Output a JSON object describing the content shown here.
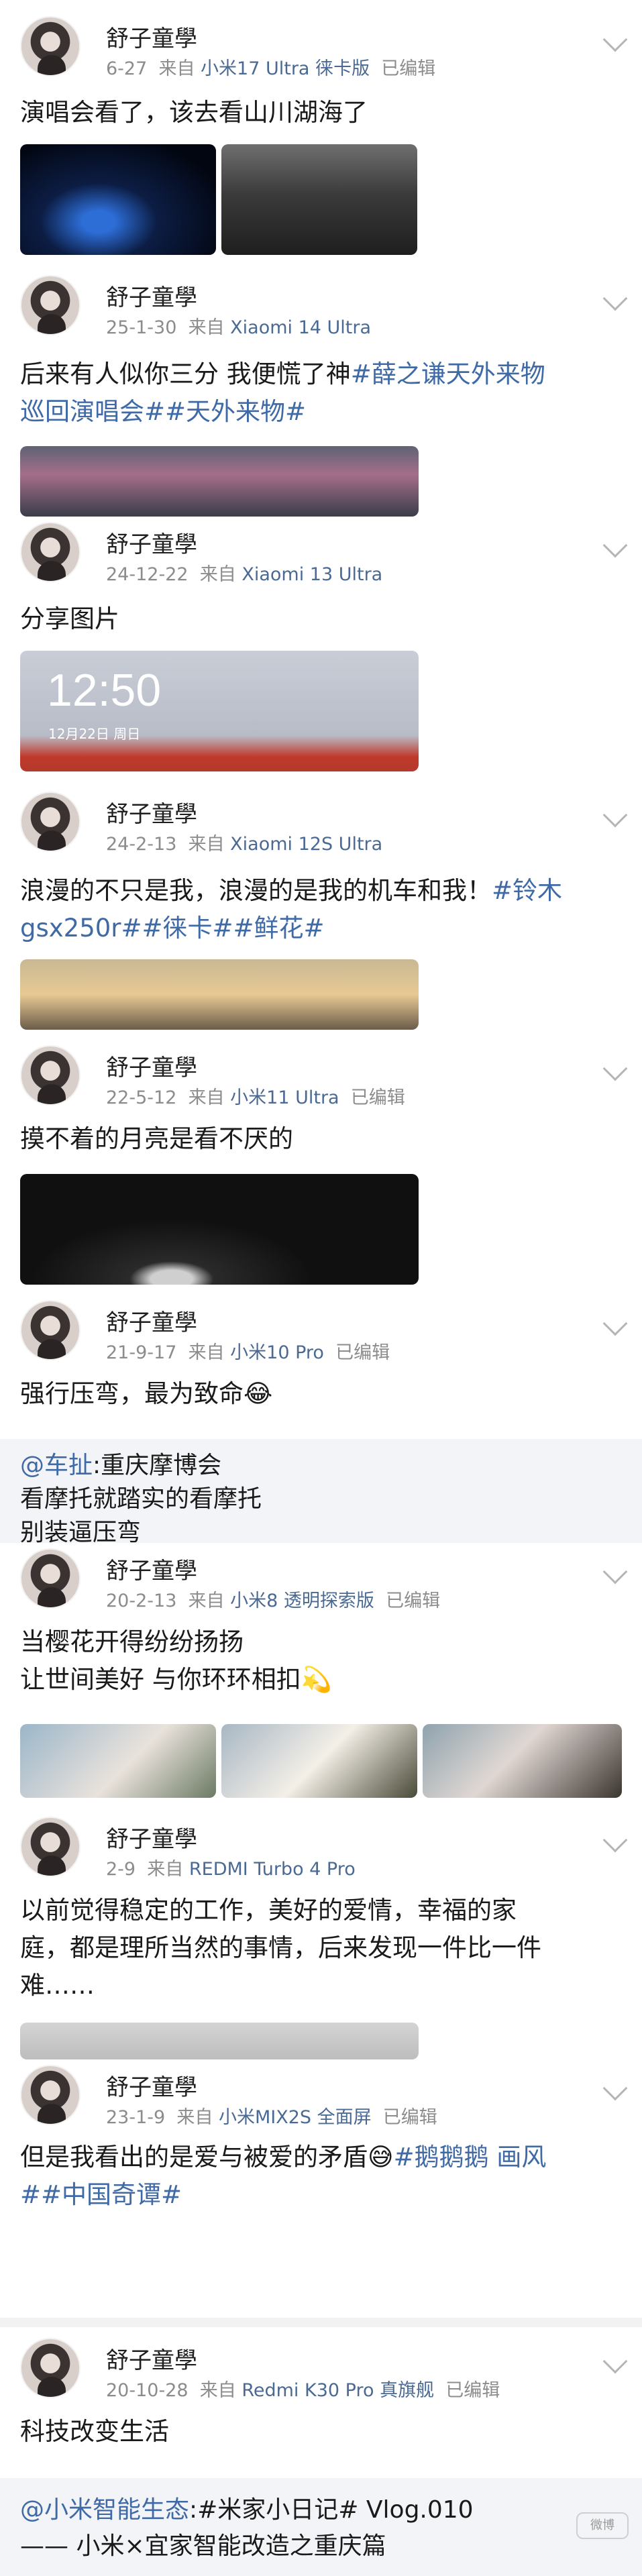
{
  "posts": [
    {
      "username": "舒子童學",
      "date": "6-27",
      "source_prefix": "来自",
      "device": "小米17 Ultra 徕卡版",
      "edited": "已编辑",
      "text": "演唱会看了，该去看山川湖海了"
    },
    {
      "username": "舒子童學",
      "date": "25-1-30",
      "source_prefix": "来自",
      "device": "Xiaomi 14 Ultra",
      "edited": "",
      "text_line1_plain": "后来有人似你三分 我便慌了神",
      "text_line1_tag": "#薛之谦天外来物",
      "text_line2_tag": "巡回演唱会##天外来物#"
    },
    {
      "username": "舒子童學",
      "date": "24-12-22",
      "source_prefix": "来自",
      "device": "Xiaomi 13 Ultra",
      "edited": "",
      "text": "分享图片",
      "lock_time": "12:50",
      "lock_date": "12月22日 周日"
    },
    {
      "username": "舒子童學",
      "date": "24-2-13",
      "source_prefix": "来自",
      "device": "Xiaomi 12S Ultra",
      "edited": "",
      "text_line1_plain": "浪漫的不只是我，浪漫的是我的机车和我！",
      "text_line1_tag": "#铃木",
      "text_line2_tag": "gsx250r##徕卡##鲜花#"
    },
    {
      "username": "舒子童學",
      "date": "22-5-12",
      "source_prefix": "来自",
      "device": "小米11 Ultra",
      "edited": "已编辑",
      "text": "摸不着的月亮是看不厌的"
    },
    {
      "username": "舒子童學",
      "date": "21-9-17",
      "source_prefix": "来自",
      "device": "小米10 Pro",
      "edited": "已编辑",
      "text": "强行压弯，最为致命😂",
      "repost_at": "@车扯",
      "repost_line1": ":重庆摩博会",
      "repost_line2": "看摩托就踏实的看摩托",
      "repost_line3": "别装逼压弯"
    },
    {
      "username": "舒子童學",
      "date": "20-2-13",
      "source_prefix": "来自",
      "device": "小米8 透明探索版",
      "edited": "已编辑",
      "text_line1": "当樱花开得纷纷扬扬",
      "text_line2": "让世间美好 与你环环相扣💫"
    },
    {
      "username": "舒子童學",
      "date": "2-9",
      "source_prefix": "来自",
      "device": "REDMI Turbo 4 Pro",
      "edited": "",
      "text_line1": "以前觉得稳定的工作，美好的爱情，幸福的家",
      "text_line2": "庭，都是理所当然的事情，后来发现一件比一件",
      "text_line3": "难……"
    },
    {
      "username": "舒子童學",
      "date": "23-1-9",
      "source_prefix": "来自",
      "device": "小米MIX2S 全面屏",
      "edited": "已编辑",
      "text_line1_plain": "但是我看出的是爱与被爱的矛盾😅",
      "text_line1_tag": "#鹅鹅鹅 画风",
      "text_line2_tag": "##中国奇谭#"
    },
    {
      "username": "舒子童學",
      "date": "20-10-28",
      "source_prefix": "来自",
      "device": "Redmi K30 Pro 真旗舰",
      "edited": "已编辑",
      "text": "科技改变生活",
      "repost_at": "@小米智能生态",
      "repost_line1": ":#米家小日记# Vlog.010",
      "repost_line2": "—— 小米×宜家智能改造之重庆篇"
    }
  ],
  "watermark": "微博"
}
